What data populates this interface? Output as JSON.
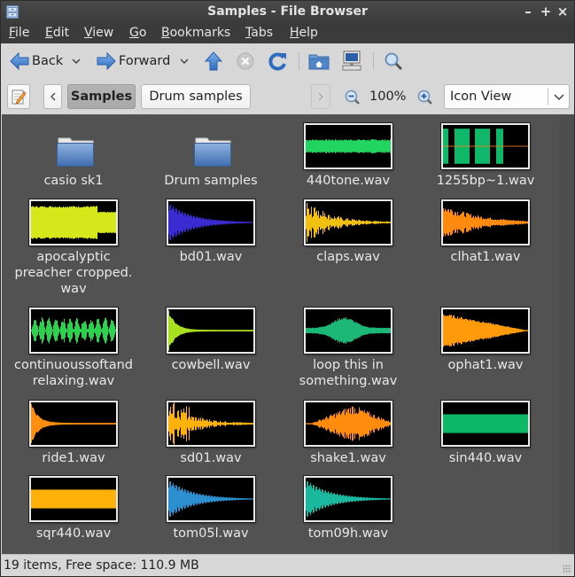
{
  "window": {
    "title": "Samples - File Browser",
    "controls": {
      "minimize": "–",
      "maximize": "+",
      "close": "×"
    }
  },
  "menu": [
    {
      "label": "File",
      "mnemonic": "F",
      "rest": "ile"
    },
    {
      "label": "Edit",
      "mnemonic": "E",
      "rest": "dit"
    },
    {
      "label": "View",
      "mnemonic": "V",
      "rest": "iew"
    },
    {
      "label": "Go",
      "mnemonic": "G",
      "rest": "o"
    },
    {
      "label": "Bookmarks",
      "mnemonic": "B",
      "rest": "ookmarks"
    },
    {
      "label": "Tabs",
      "mnemonic": "T",
      "rest": "abs"
    },
    {
      "label": "Help",
      "mnemonic": "H",
      "rest": "elp"
    }
  ],
  "toolbar": {
    "back_label": "Back",
    "forward_label": "Forward",
    "icons": [
      "back-arrow-icon",
      "forward-arrow-icon",
      "up-arrow-icon",
      "stop-icon",
      "reload-icon",
      "home-folder-icon",
      "computer-icon",
      "search-icon"
    ]
  },
  "location": {
    "path": [
      "Samples",
      "Drum samples"
    ],
    "active_index": 0,
    "zoom_level": "100%",
    "view_mode": "Icon View"
  },
  "items": [
    {
      "name": "casio sk1",
      "type": "folder"
    },
    {
      "name": "Drum samples",
      "type": "folder"
    },
    {
      "name": "440tone.wav",
      "type": "wav",
      "color": "#22d460",
      "shape": "tone"
    },
    {
      "name": "1255bp~1.wav",
      "type": "wav",
      "color": "#0fb868",
      "shape": "bursts"
    },
    {
      "name": "apocalyptic preacher cropped.wav",
      "lines": [
        "apocalyptic",
        "preacher cropped.",
        "wav"
      ],
      "type": "wav",
      "color": "#d6e81a",
      "shape": "dense"
    },
    {
      "name": "bd01.wav",
      "type": "wav",
      "color": "#3a2bd0",
      "shape": "decay-osc"
    },
    {
      "name": "claps.wav",
      "type": "wav",
      "color": "#f2c00e",
      "shape": "decay-spiky"
    },
    {
      "name": "clhat1.wav",
      "type": "wav",
      "color": "#ff8a10",
      "shape": "decay"
    },
    {
      "name": "continuoussoftandrelaxing.wav",
      "lines": [
        "continuoussoftand",
        "relaxing.wav"
      ],
      "type": "wav",
      "color": "#2ed050",
      "shape": "blobs"
    },
    {
      "name": "cowbell.wav",
      "type": "wav",
      "color": "#a8e020",
      "shape": "sharp-decay"
    },
    {
      "name": "loop this in something.wav",
      "lines": [
        "loop this in",
        "something.wav"
      ],
      "type": "wav",
      "color": "#1bb878",
      "shape": "swell"
    },
    {
      "name": "ophat1.wav",
      "type": "wav",
      "color": "#ff9b0a",
      "shape": "long-decay"
    },
    {
      "name": "ride1.wav",
      "type": "wav",
      "color": "#ff8e10",
      "shape": "sharp-decay"
    },
    {
      "name": "sd01.wav",
      "type": "wav",
      "color": "#ffb20a",
      "shape": "decay-spiky"
    },
    {
      "name": "shake1.wav",
      "type": "wav",
      "color": "#ff8c0c",
      "shape": "diamond"
    },
    {
      "name": "sin440.wav",
      "type": "wav",
      "color": "#0cb866",
      "shape": "block"
    },
    {
      "name": "sqr440.wav",
      "type": "wav",
      "color": "#ffb10a",
      "shape": "block"
    },
    {
      "name": "tom05l.wav",
      "type": "wav",
      "color": "#2b8fd0",
      "shape": "decay-osc"
    },
    {
      "name": "tom09h.wav",
      "type": "wav",
      "color": "#1bb8a0",
      "shape": "decay-osc"
    }
  ],
  "status": {
    "text": "19 items, Free space: 110.9 MB"
  }
}
